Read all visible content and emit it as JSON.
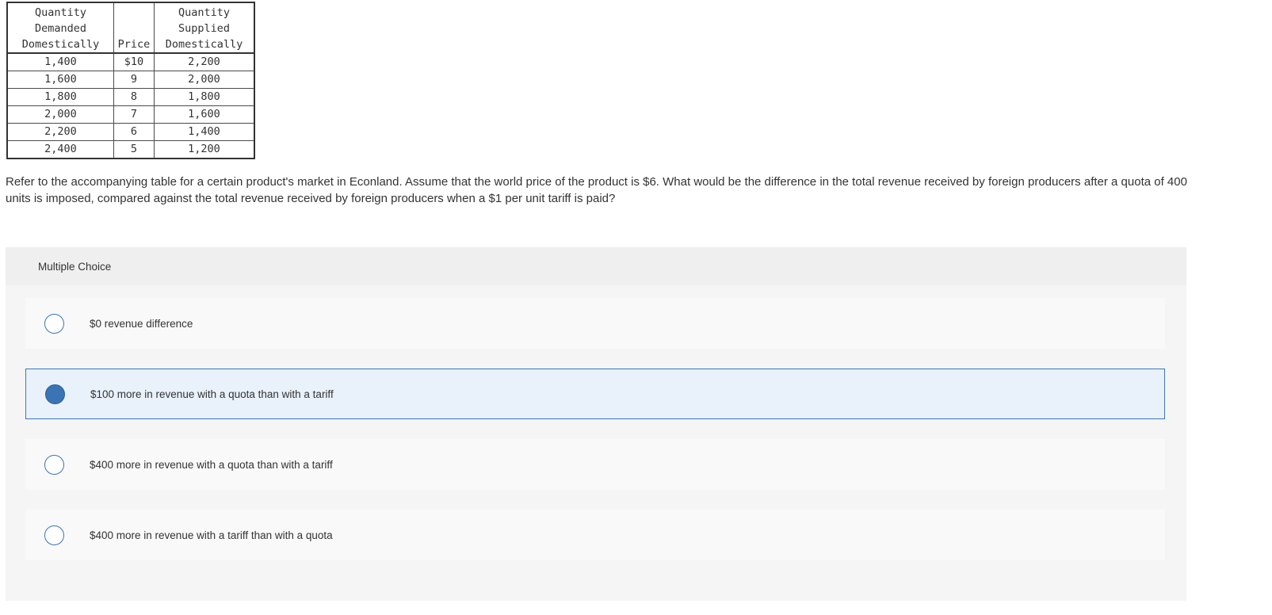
{
  "table": {
    "headers": {
      "demanded": [
        "Quantity",
        "Demanded",
        "Domestically"
      ],
      "price": [
        "Price"
      ],
      "supplied": [
        "Quantity",
        "Supplied",
        "Domestically"
      ]
    },
    "rows": [
      {
        "demanded": "1,400",
        "price": "$10",
        "supplied": "2,200"
      },
      {
        "demanded": "1,600",
        "price": "9",
        "supplied": "2,000"
      },
      {
        "demanded": "1,800",
        "price": "8",
        "supplied": "1,800"
      },
      {
        "demanded": "2,000",
        "price": "7",
        "supplied": "1,600"
      },
      {
        "demanded": "2,200",
        "price": "6",
        "supplied": "1,400"
      },
      {
        "demanded": "2,400",
        "price": "5",
        "supplied": "1,200"
      }
    ]
  },
  "question": {
    "text": "Refer to the accompanying table for a certain product's market in Econland. Assume that the world price of the product is $6. What would be the difference in the total revenue received by foreign producers after a quota of 400 units is imposed, compared against the total revenue received by foreign producers when a $1 per unit tariff is paid?"
  },
  "multiple_choice": {
    "header": "Multiple Choice",
    "options": [
      {
        "label": "$0 revenue difference",
        "selected": false
      },
      {
        "label": "$100 more in revenue with a quota than with a tariff",
        "selected": true
      },
      {
        "label": "$400 more in revenue with a quota than with a tariff",
        "selected": false
      },
      {
        "label": "$400 more in revenue with a tariff than with a quota",
        "selected": false
      }
    ]
  },
  "colors": {
    "accent": "#3b74b5",
    "selected_background": "#e9f1fb",
    "panel_background": "#f5f5f5"
  }
}
